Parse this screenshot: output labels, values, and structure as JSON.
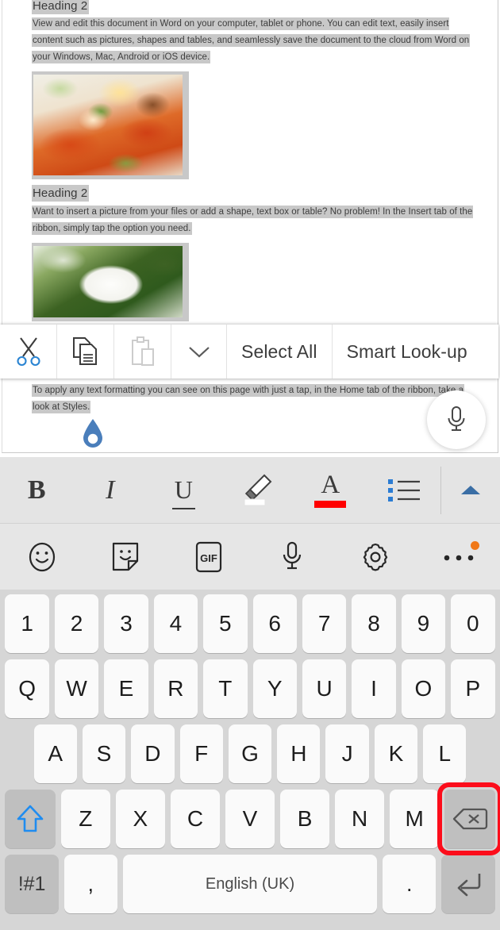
{
  "document": {
    "heading_1": "Heading 2",
    "paragraph_1": "View and edit this document in Word on your computer, tablet or phone. You can edit text, easily insert content such as pictures, shapes and tables, and seamlessly save the document to the cloud from Word on your Windows, Mac, Android or iOS device.",
    "image_1_name": "stuffed-red-peppers-photo",
    "heading_2": "Heading 2",
    "paragraph_2": "Want to insert a picture from your files or add a shape, text box or table? No problem! In the Insert tab of the ribbon, simply tap the option you need.",
    "image_2_name": "white-rice-cake-on-green-leaf-photo",
    "paragraph_3": "To apply any text formatting you can see on this page with just a tap, in the Home tab of the ribbon, take a look at Styles.",
    "selection_highlight_color": "#c8c8c8",
    "selection_handle_color": "#4a7ebb"
  },
  "context_menu": {
    "items": [
      {
        "name": "cut",
        "label": "Cut",
        "icon": "scissors-icon",
        "enabled": true
      },
      {
        "name": "copy",
        "label": "Copy",
        "icon": "copy-icon",
        "enabled": true
      },
      {
        "name": "paste",
        "label": "Paste",
        "icon": "paste-icon",
        "enabled": false
      },
      {
        "name": "more",
        "label": "More",
        "icon": "chevron-down-icon",
        "enabled": true
      }
    ],
    "select_all_label": "Select All",
    "smart_lookup_label": "Smart Look-up"
  },
  "mic_fab": {
    "name": "dictate-microphone",
    "icon": "microphone-icon"
  },
  "formatting_toolbar": {
    "bold_label": "B",
    "italic_label": "I",
    "underline_label": "U",
    "highlighter_icon": "highlighter-pen-icon",
    "font_color_label": "A",
    "font_color_swatch": "#ff0000",
    "bullet_list_icon": "bullet-list-icon",
    "bullet_marker_color": "#2b7cd3",
    "collapse_icon": "chevron-up-icon",
    "collapse_color": "#3a6ea5",
    "background": "#e4e4e4"
  },
  "keyboard_toolbar": {
    "items": [
      {
        "name": "emoji",
        "icon": "smiley-face-icon"
      },
      {
        "name": "sticker",
        "icon": "sticker-icon"
      },
      {
        "name": "gif",
        "icon": "gif-icon",
        "label": "GIF"
      },
      {
        "name": "voice-input",
        "icon": "microphone-icon"
      },
      {
        "name": "settings",
        "icon": "gear-icon"
      },
      {
        "name": "more-options",
        "icon": "overflow-dots-icon",
        "badge": true,
        "badge_color": "#f07818"
      }
    ]
  },
  "keyboard": {
    "language_label": "English (UK)",
    "symbols_label": "!#1",
    "comma_label": ",",
    "period_label": ".",
    "shift_icon": "shift-arrow-icon",
    "shift_color": "#1f8cf0",
    "backspace_icon": "backspace-icon",
    "enter_icon": "enter-return-icon",
    "rows": [
      [
        "1",
        "2",
        "3",
        "4",
        "5",
        "6",
        "7",
        "8",
        "9",
        "0"
      ],
      [
        "Q",
        "W",
        "E",
        "R",
        "T",
        "Y",
        "U",
        "I",
        "O",
        "P"
      ],
      [
        "A",
        "S",
        "D",
        "F",
        "G",
        "H",
        "J",
        "K",
        "L"
      ],
      [
        "Z",
        "X",
        "C",
        "V",
        "B",
        "N",
        "M"
      ]
    ],
    "highlighted_key": "backspace",
    "highlight_color": "#fc0d1b",
    "key_background": "#fafafa",
    "modifier_key_background": "#bfbfbf",
    "keyboard_background": "#d6d6d6"
  }
}
